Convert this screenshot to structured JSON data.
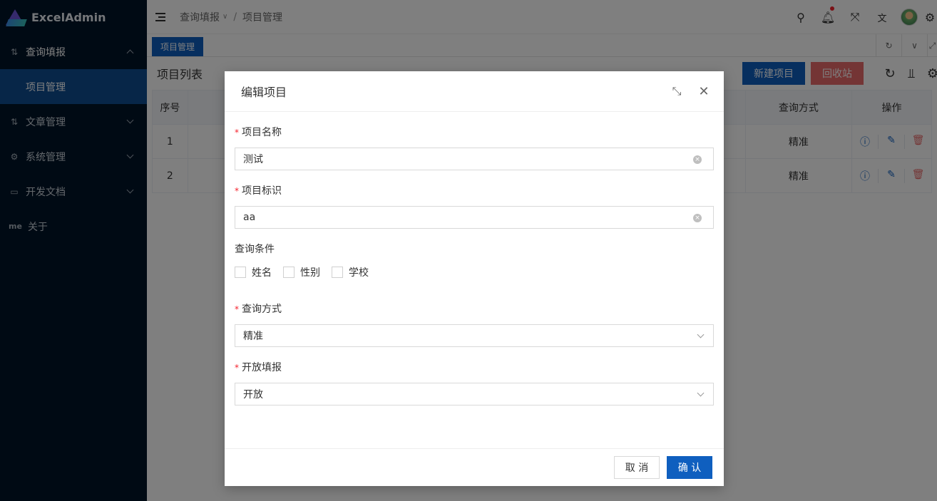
{
  "app": {
    "title": "ExcelAdmin"
  },
  "sidebar": {
    "items": [
      {
        "label": "查询填报",
        "icon": "query-icon",
        "open": true
      },
      {
        "label": "项目管理",
        "sub": true,
        "active": true
      },
      {
        "label": "文章管理",
        "icon": "article-icon"
      },
      {
        "label": "系统管理",
        "icon": "gear-icon"
      },
      {
        "label": "开发文档",
        "icon": "monitor-icon"
      },
      {
        "label": "关于",
        "icon_text": "me"
      }
    ]
  },
  "header": {
    "breadcrumb": [
      "查询填报",
      "项目管理"
    ],
    "separator": "/"
  },
  "tabs": [
    {
      "label": "项目管理",
      "active": true
    }
  ],
  "list": {
    "title": "项目列表",
    "new_button": "新建项目",
    "recycle_button": "回收站",
    "columns": {
      "index": "序号",
      "query_mode": "查询方式",
      "actions": "操作"
    },
    "rows": [
      {
        "index": "1",
        "query_mode": "精准"
      },
      {
        "index": "2",
        "query_mode": "精准"
      }
    ]
  },
  "modal": {
    "title": "编辑项目",
    "fields": {
      "name": {
        "label": "项目名称",
        "value": "测试",
        "required": true
      },
      "identifier": {
        "label": "项目标识",
        "value": "aa",
        "required": true
      },
      "conditions": {
        "label": "查询条件",
        "options": [
          "姓名",
          "性别",
          "学校"
        ]
      },
      "query_mode": {
        "label": "查询方式",
        "value": "精准",
        "required": true
      },
      "open_fill": {
        "label": "开放填报",
        "value": "开放",
        "required": true
      }
    },
    "required_mark": "*",
    "cancel": "取 消",
    "confirm": "确 认"
  },
  "colors": {
    "sidebar_bg": "#001529",
    "primary": "#0f5fbf",
    "danger": "#e86a6a",
    "required": "#f5222d"
  }
}
